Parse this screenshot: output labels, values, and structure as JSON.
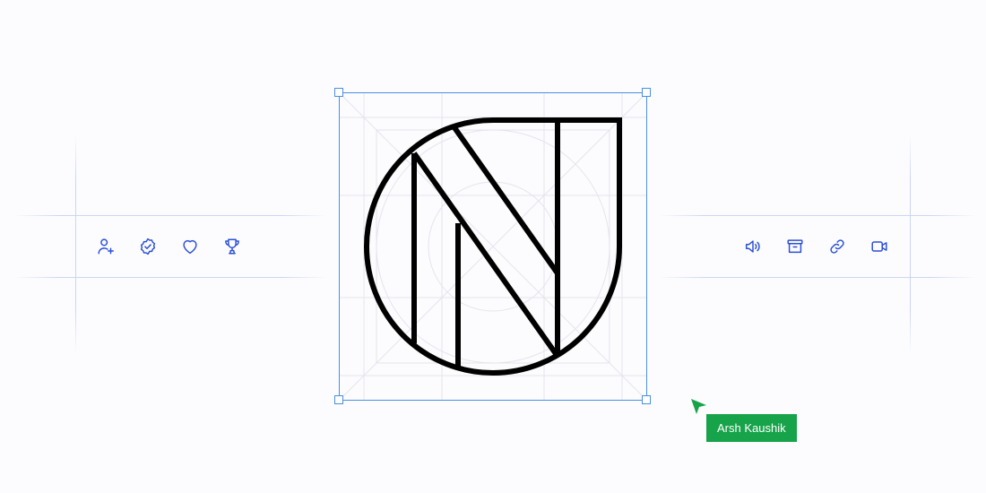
{
  "colors": {
    "background": "#fcfcfe",
    "guide": "#cad6f2",
    "icon": "#2b4fd6",
    "selection": "#4a8fe0",
    "logo_stroke": "#000000",
    "collaborator": "#17a34a"
  },
  "left_icons": [
    {
      "name": "user-plus-icon"
    },
    {
      "name": "verified-badge-icon"
    },
    {
      "name": "heart-icon"
    },
    {
      "name": "trophy-icon"
    }
  ],
  "right_icons": [
    {
      "name": "volume-icon"
    },
    {
      "name": "archive-icon"
    },
    {
      "name": "link-icon"
    },
    {
      "name": "video-camera-icon"
    }
  ],
  "collaborator": {
    "name": "Arsh Kaushik"
  }
}
